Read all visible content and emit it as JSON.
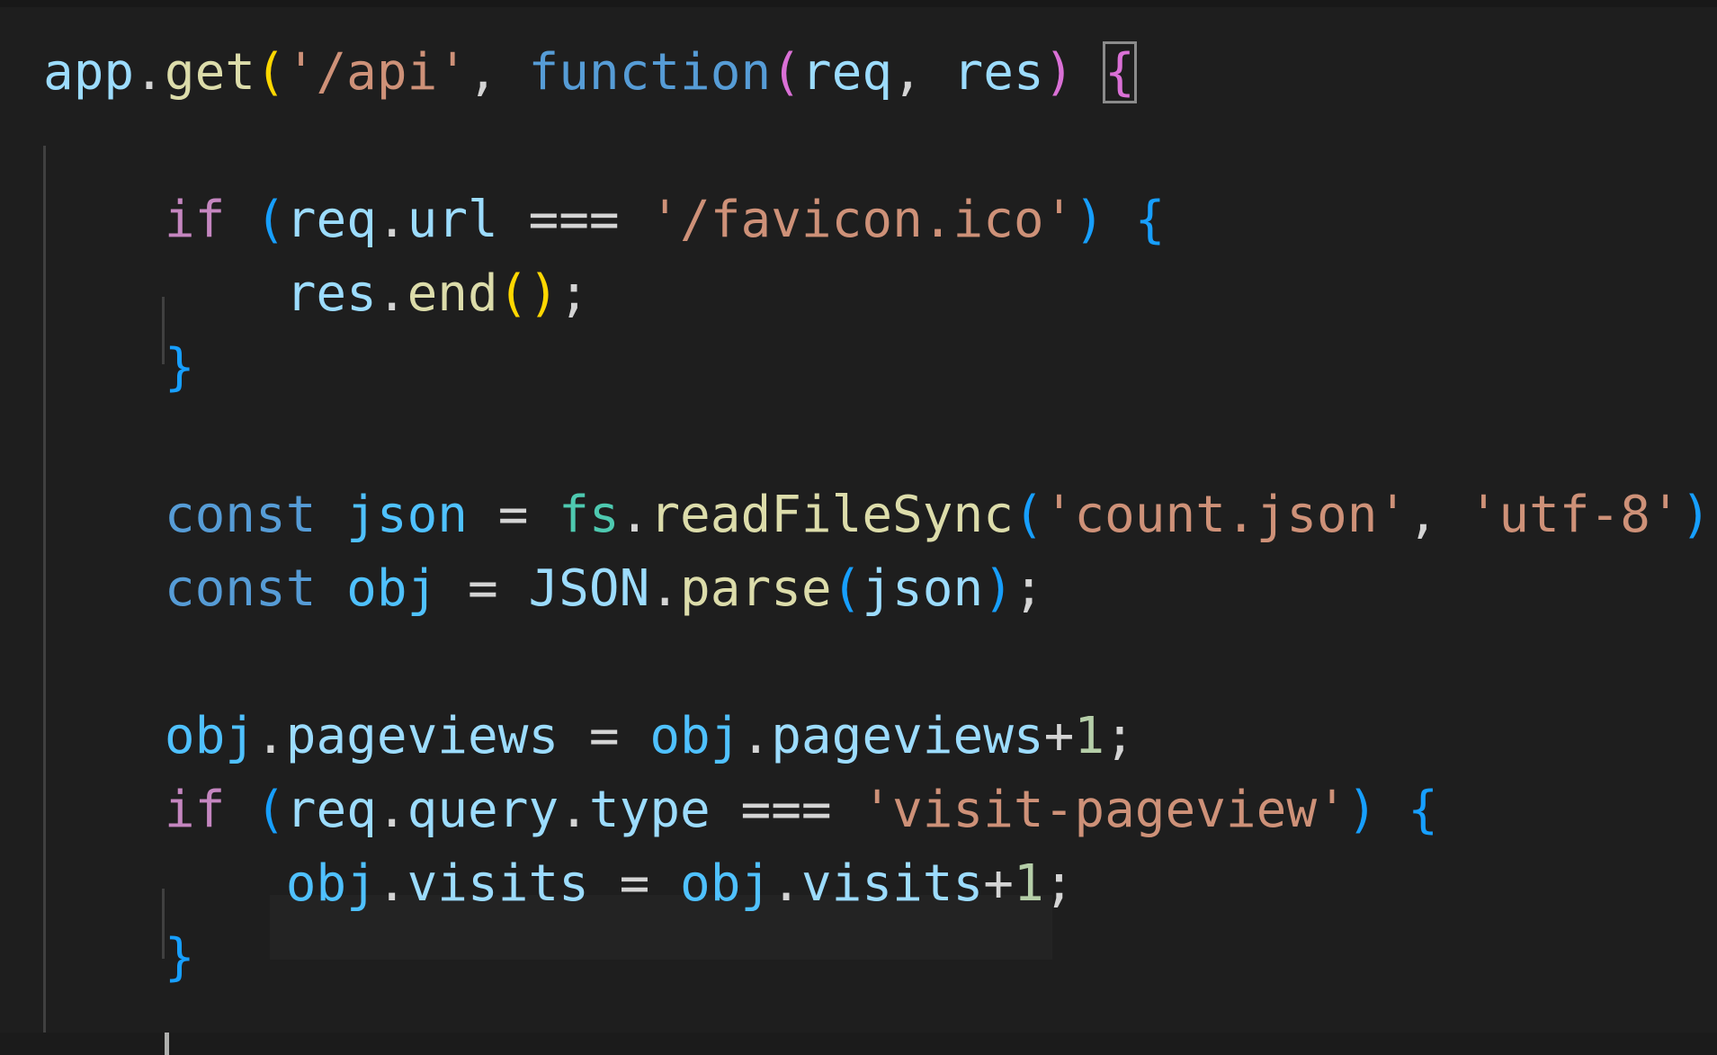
{
  "editor": {
    "language": "javascript",
    "theme_colors": {
      "background": "#1e1e1e",
      "variable": "#9cdcfe",
      "function": "#dcdcaa",
      "keyword_control": "#c586c0",
      "keyword_storage": "#569cd6",
      "string": "#ce9178",
      "number": "#b5cea8",
      "type": "#4ec9b0",
      "bracket_gold": "#ffd700",
      "bracket_purple": "#da70d6",
      "bracket_blue": "#179fff",
      "punctuation": "#d4d4d4"
    },
    "lines": [
      {
        "tokens": [
          {
            "t": "app",
            "c": "#9cdcfe"
          },
          {
            "t": ".",
            "c": "#d4d4d4"
          },
          {
            "t": "get",
            "c": "#dcdcaa"
          },
          {
            "t": "(",
            "c": "#ffd700"
          },
          {
            "t": "'/api'",
            "c": "#ce9178"
          },
          {
            "t": ", ",
            "c": "#d4d4d4"
          },
          {
            "t": "function",
            "c": "#569cd6"
          },
          {
            "t": "(",
            "c": "#da70d6"
          },
          {
            "t": "req",
            "c": "#9cdcfe"
          },
          {
            "t": ", ",
            "c": "#d4d4d4"
          },
          {
            "t": "res",
            "c": "#9cdcfe"
          },
          {
            "t": ")",
            "c": "#da70d6"
          },
          {
            "t": " ",
            "c": "#d4d4d4"
          },
          {
            "t": "{",
            "c": "#da70d6",
            "boxed": true
          }
        ]
      },
      {
        "tokens": []
      },
      {
        "tokens": [
          {
            "t": "    ",
            "c": "#d4d4d4"
          },
          {
            "t": "if",
            "c": "#c586c0"
          },
          {
            "t": " ",
            "c": "#d4d4d4"
          },
          {
            "t": "(",
            "c": "#179fff"
          },
          {
            "t": "req",
            "c": "#9cdcfe"
          },
          {
            "t": ".",
            "c": "#d4d4d4"
          },
          {
            "t": "url",
            "c": "#9cdcfe"
          },
          {
            "t": " === ",
            "c": "#d4d4d4"
          },
          {
            "t": "'/favicon.ico'",
            "c": "#ce9178"
          },
          {
            "t": ")",
            "c": "#179fff"
          },
          {
            "t": " ",
            "c": "#d4d4d4"
          },
          {
            "t": "{",
            "c": "#179fff"
          }
        ]
      },
      {
        "tokens": [
          {
            "t": "        ",
            "c": "#d4d4d4"
          },
          {
            "t": "res",
            "c": "#9cdcfe"
          },
          {
            "t": ".",
            "c": "#d4d4d4"
          },
          {
            "t": "end",
            "c": "#dcdcaa"
          },
          {
            "t": "()",
            "c": "#ffd700"
          },
          {
            "t": ";",
            "c": "#d4d4d4"
          }
        ]
      },
      {
        "tokens": [
          {
            "t": "    ",
            "c": "#d4d4d4"
          },
          {
            "t": "}",
            "c": "#179fff"
          }
        ]
      },
      {
        "tokens": []
      },
      {
        "tokens": [
          {
            "t": "    ",
            "c": "#d4d4d4"
          },
          {
            "t": "const",
            "c": "#569cd6"
          },
          {
            "t": " ",
            "c": "#d4d4d4"
          },
          {
            "t": "json",
            "c": "#4fc1ff"
          },
          {
            "t": " = ",
            "c": "#d4d4d4"
          },
          {
            "t": "fs",
            "c": "#4ec9b0"
          },
          {
            "t": ".",
            "c": "#d4d4d4"
          },
          {
            "t": "readFileSync",
            "c": "#dcdcaa"
          },
          {
            "t": "(",
            "c": "#179fff"
          },
          {
            "t": "'count.json'",
            "c": "#ce9178"
          },
          {
            "t": ", ",
            "c": "#d4d4d4"
          },
          {
            "t": "'utf-8'",
            "c": "#ce9178"
          },
          {
            "t": ")",
            "c": "#179fff"
          },
          {
            "t": ";",
            "c": "#d4d4d4"
          }
        ]
      },
      {
        "tokens": [
          {
            "t": "    ",
            "c": "#d4d4d4"
          },
          {
            "t": "const",
            "c": "#569cd6"
          },
          {
            "t": " ",
            "c": "#d4d4d4"
          },
          {
            "t": "obj",
            "c": "#4fc1ff"
          },
          {
            "t": " = ",
            "c": "#d4d4d4"
          },
          {
            "t": "JSON",
            "c": "#9cdcfe"
          },
          {
            "t": ".",
            "c": "#d4d4d4"
          },
          {
            "t": "parse",
            "c": "#dcdcaa"
          },
          {
            "t": "(",
            "c": "#179fff"
          },
          {
            "t": "json",
            "c": "#9cdcfe"
          },
          {
            "t": ")",
            "c": "#179fff"
          },
          {
            "t": ";",
            "c": "#d4d4d4"
          }
        ]
      },
      {
        "tokens": []
      },
      {
        "tokens": [
          {
            "t": "    ",
            "c": "#d4d4d4"
          },
          {
            "t": "obj",
            "c": "#4fc1ff"
          },
          {
            "t": ".",
            "c": "#d4d4d4"
          },
          {
            "t": "pageviews",
            "c": "#9cdcfe"
          },
          {
            "t": " = ",
            "c": "#d4d4d4"
          },
          {
            "t": "obj",
            "c": "#4fc1ff"
          },
          {
            "t": ".",
            "c": "#d4d4d4"
          },
          {
            "t": "pageviews",
            "c": "#9cdcfe"
          },
          {
            "t": "+",
            "c": "#d4d4d4"
          },
          {
            "t": "1",
            "c": "#b5cea8"
          },
          {
            "t": ";",
            "c": "#d4d4d4"
          }
        ]
      },
      {
        "tokens": [
          {
            "t": "    ",
            "c": "#d4d4d4"
          },
          {
            "t": "if",
            "c": "#c586c0"
          },
          {
            "t": " ",
            "c": "#d4d4d4"
          },
          {
            "t": "(",
            "c": "#179fff"
          },
          {
            "t": "req",
            "c": "#9cdcfe"
          },
          {
            "t": ".",
            "c": "#d4d4d4"
          },
          {
            "t": "query",
            "c": "#9cdcfe"
          },
          {
            "t": ".",
            "c": "#d4d4d4"
          },
          {
            "t": "type",
            "c": "#9cdcfe"
          },
          {
            "t": " === ",
            "c": "#d4d4d4"
          },
          {
            "t": "'visit-pageview'",
            "c": "#ce9178"
          },
          {
            "t": ")",
            "c": "#179fff"
          },
          {
            "t": " ",
            "c": "#d4d4d4"
          },
          {
            "t": "{",
            "c": "#179fff"
          }
        ]
      },
      {
        "tokens": [
          {
            "t": "        ",
            "c": "#d4d4d4"
          },
          {
            "t": "obj",
            "c": "#4fc1ff"
          },
          {
            "t": ".",
            "c": "#d4d4d4"
          },
          {
            "t": "visits",
            "c": "#9cdcfe"
          },
          {
            "t": " = ",
            "c": "#d4d4d4"
          },
          {
            "t": "obj",
            "c": "#4fc1ff"
          },
          {
            "t": ".",
            "c": "#d4d4d4"
          },
          {
            "t": "visits",
            "c": "#9cdcfe"
          },
          {
            "t": "+",
            "c": "#d4d4d4"
          },
          {
            "t": "1",
            "c": "#b5cea8"
          },
          {
            "t": ";",
            "c": "#d4d4d4"
          }
        ]
      },
      {
        "tokens": [
          {
            "t": "    ",
            "c": "#d4d4d4"
          },
          {
            "t": "}",
            "c": "#179fff"
          }
        ]
      }
    ]
  }
}
